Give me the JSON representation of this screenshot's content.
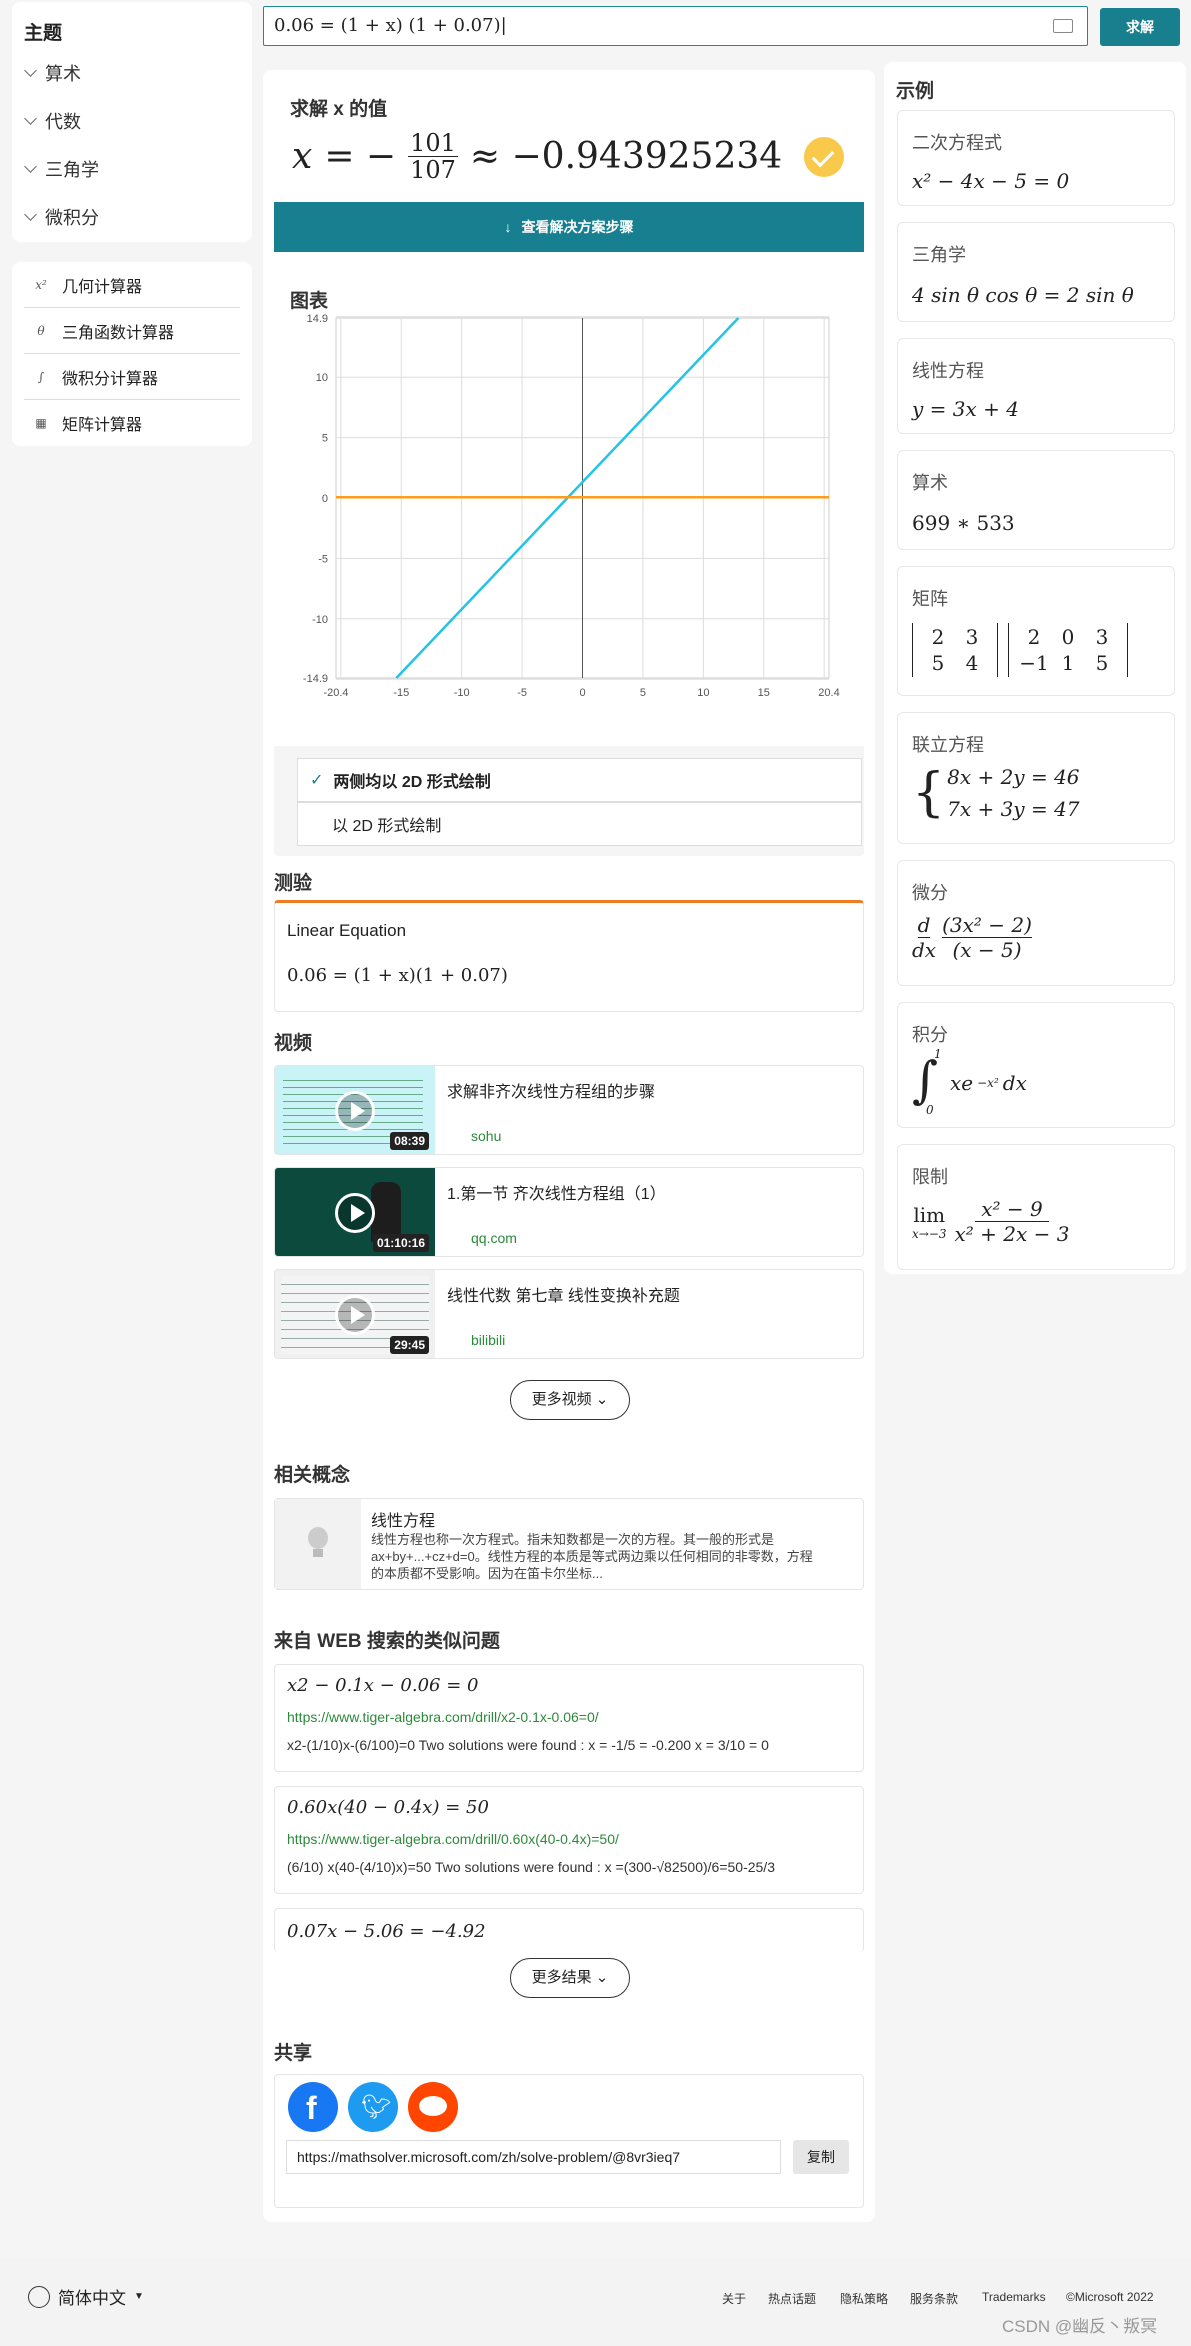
{
  "search": {
    "value": "0.06 = (1 + x) (1 + 0.07)|",
    "solve_label": "求解"
  },
  "sidebar": {
    "topic_title": "主题",
    "topics": [
      "算术",
      "代数",
      "三角学",
      "微积分"
    ],
    "tools": [
      {
        "icon": "x²",
        "label": "几何计算器"
      },
      {
        "icon": "θ",
        "label": "三角函数计算器"
      },
      {
        "icon": "∫",
        "label": "微积分计算器"
      },
      {
        "icon": "▦",
        "label": "矩阵计算器"
      }
    ]
  },
  "solve": {
    "title": "求解 x 的值",
    "var": "x",
    "num": "101",
    "den": "107",
    "approx": "≈ −0.943925234",
    "steps_label": "查看解决方案步骤"
  },
  "graph": {
    "title": "图表",
    "opt1": "两侧均以 2D 形式绘制",
    "opt2": "以 2D 形式绘制"
  },
  "chart_data": {
    "type": "line",
    "xlim": [
      -20.4,
      20.4
    ],
    "ylim": [
      -14.9,
      14.9
    ],
    "grid": true,
    "x_ticks": [
      -20,
      -15,
      -10,
      -5,
      0,
      5,
      10,
      15,
      20
    ],
    "x_tick_labels": [
      "-20.4",
      "-15",
      "-10",
      "-5",
      "0",
      "5",
      "10",
      "15",
      "20.4"
    ],
    "y_ticks": [
      14.9,
      10,
      5,
      0,
      -5,
      -10,
      -14.9
    ],
    "y_tick_labels": [
      "14.9",
      "10",
      "5",
      "0",
      "-5",
      "-10",
      "-14.9"
    ],
    "series": [
      {
        "color": "#24c3e4",
        "x": [
          -15.4,
          12.9
        ],
        "y": [
          -14.9,
          14.9
        ]
      },
      {
        "color": "#ff9d1a",
        "x": [
          -20.4,
          20.4
        ],
        "y": [
          0.06,
          0.06
        ]
      }
    ]
  },
  "quiz": {
    "title": "测验",
    "subtitle": "Linear Equation",
    "eq": "0.06 = (1 + x)(1 + 0.07)"
  },
  "videos": {
    "title": "视频",
    "items": [
      {
        "title": "求解非齐次线性方程组的步骤",
        "source": "sohu",
        "duration": "08:39"
      },
      {
        "title": "1.第一节 齐次线性方程组（1）",
        "source": "qq.com",
        "duration": "01:10:16"
      },
      {
        "title": "线性代数 第七章 线性变换补充题",
        "source": "bilibili",
        "duration": "29:45"
      }
    ],
    "more_label": "更多视频"
  },
  "concept": {
    "title": "相关概念",
    "name": "线性方程",
    "desc1": "线性方程也称一次方程式。指未知数都是一次的方程。其一般的形式是",
    "desc2": "ax+by+...+cz+d=0。线性方程的本质是等式两边乘以任何相同的非零数，方程",
    "desc3": "的本质都不受影响。因为在笛卡尔坐标..."
  },
  "web": {
    "title": "来自 WEB 搜索的类似问题",
    "items": [
      {
        "eq": "x2 − 0.1x − 0.06 = 0",
        "link": "https://www.tiger-algebra.com/drill/x2-0.1x-0.06=0/",
        "desc": "x2-(1/10)x-(6/100)=0 Two solutions were found : x = -1/5 = -0.200  x = 3/10 = 0"
      },
      {
        "eq": "0.60x(40 − 0.4x) = 50",
        "link": "https://www.tiger-algebra.com/drill/0.60x(40-0.4x)=50/",
        "desc": "(6/10) x(40-(4/10)x)=50 Two solutions were found : x =(300-√82500)/6=50-25/3"
      },
      {
        "eq": "0.07x − 5.06 = −4.92",
        "link": "",
        "desc": ""
      }
    ],
    "more_label": "更多结果"
  },
  "share": {
    "title": "共享",
    "url": "https://mathsolver.microsoft.com/zh/solve-problem/@8vr3ieq7",
    "copy_label": "复制"
  },
  "examples": {
    "title": "示例",
    "items": [
      {
        "label": "二次方程式",
        "math": "x² − 4x − 5 = 0"
      },
      {
        "label": "三角学",
        "math": "4 sin θ cos θ = 2 sin θ"
      },
      {
        "label": "线性方程",
        "math": "y = 3x + 4"
      },
      {
        "label": "算术",
        "math": "699 ∗ 533"
      },
      {
        "label": "矩阵",
        "m1": [
          "2",
          "3",
          "5",
          "4"
        ],
        "m2": [
          "2",
          "0",
          "3",
          "−1",
          "1",
          "5"
        ]
      },
      {
        "label": "联立方程",
        "eq1": "8x + 2y = 46",
        "eq2": "7x + 3y = 47"
      },
      {
        "label": "微分",
        "num": "d",
        "den": "dx",
        "fnum": "(3x² − 2)",
        "fden": "(x − 5)"
      },
      {
        "label": "积分",
        "upper": "1",
        "lower": "0",
        "body": "xe",
        "exp": "−x²",
        "dx": "dx"
      },
      {
        "label": "限制",
        "lim": "lim",
        "sub": "x→−3",
        "fnum": "x² − 9",
        "fden": "x² + 2x − 3"
      }
    ]
  },
  "footer": {
    "lang": "简体中文",
    "links": [
      "关于",
      "热点话题",
      "隐私策略",
      "服务条款",
      "Trademarks",
      "©Microsoft 2022"
    ],
    "watermark": "CSDN @幽反丶叛冥"
  }
}
